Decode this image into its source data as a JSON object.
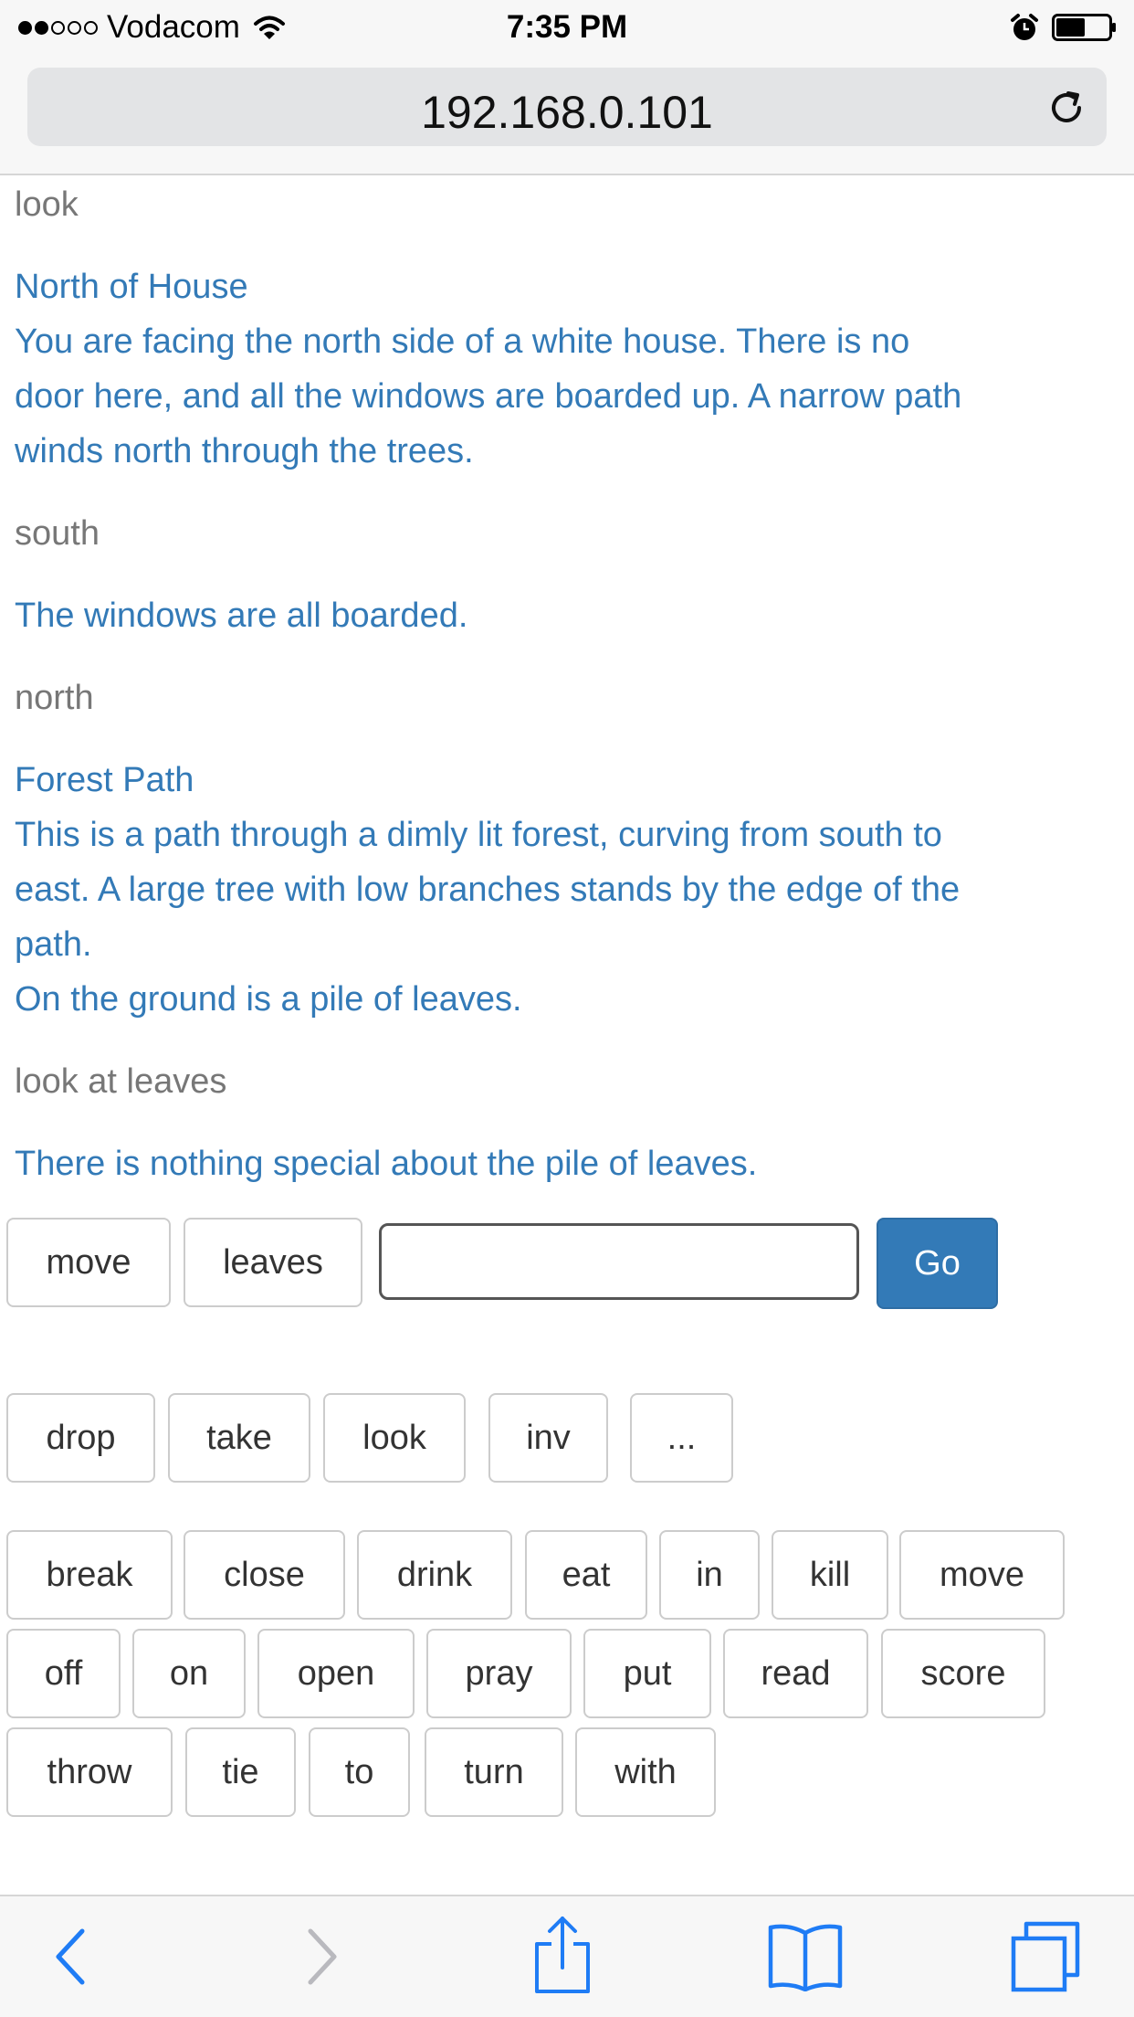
{
  "status_bar": {
    "carrier": "Vodacom",
    "time": "7:35 PM",
    "signal_bars_filled": 2,
    "signal_bars_total": 5,
    "battery_level": 0.55
  },
  "browser": {
    "url": "192.168.0.101"
  },
  "transcript": {
    "entries": [
      {
        "type": "command",
        "text": "look"
      },
      {
        "type": "response",
        "lines": [
          "North of House",
          "You are facing the north side of a white house. There is no",
          "door here, and all the windows are boarded up. A narrow path",
          "winds north through the trees."
        ]
      },
      {
        "type": "command",
        "text": "south"
      },
      {
        "type": "response",
        "lines": [
          "The windows are all boarded."
        ]
      },
      {
        "type": "command",
        "text": "north"
      },
      {
        "type": "response",
        "lines": [
          "Forest Path",
          "This is a path through a dimly lit forest, curving from south to",
          "east. A large tree with low branches stands by the edge of the",
          "path.",
          "On the ground is a pile of leaves."
        ]
      },
      {
        "type": "command",
        "text": "look at leaves"
      },
      {
        "type": "response",
        "lines": [
          "There is nothing special about the pile of leaves."
        ]
      }
    ]
  },
  "input_row": {
    "word_buttons": [
      "move",
      "leaves"
    ],
    "input_value": "",
    "go_label": "Go"
  },
  "common_actions": [
    "drop",
    "take",
    "look",
    "inv",
    "..."
  ],
  "verbs": {
    "row1": [
      "break",
      "close",
      "drink",
      "eat",
      "in",
      "kill",
      "move"
    ],
    "row2": [
      "off",
      "on",
      "open",
      "pray",
      "put",
      "read",
      "score"
    ],
    "row3": [
      "throw",
      "tie",
      "to",
      "turn",
      "with"
    ]
  },
  "colors": {
    "response_text": "#337ab7",
    "command_text": "#777777",
    "go_button": "#337ab7"
  },
  "toolbar": {
    "icons": [
      "back-icon",
      "forward-icon",
      "share-icon",
      "bookmarks-icon",
      "tabs-icon"
    ]
  }
}
